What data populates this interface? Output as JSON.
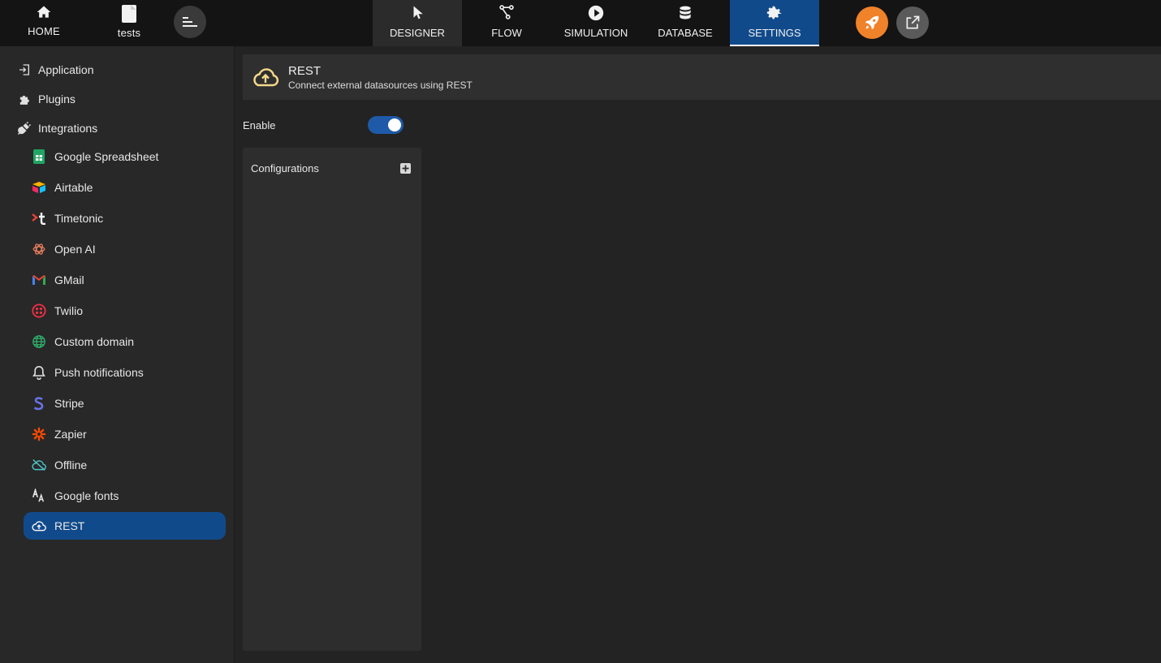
{
  "topbar": {
    "home_label": "HOME",
    "project_label": "tests",
    "tabs": [
      {
        "label": "DESIGNER"
      },
      {
        "label": "FLOW"
      },
      {
        "label": "SIMULATION"
      },
      {
        "label": "DATABASE"
      },
      {
        "label": "SETTINGS"
      }
    ],
    "active_tab": "SETTINGS",
    "colors": {
      "accent": "#114a8b",
      "rocket": "#f0822a"
    }
  },
  "sidebar": {
    "sections": [
      {
        "label": "Application",
        "icon": "login-icon"
      },
      {
        "label": "Plugins",
        "icon": "puzzle-icon"
      },
      {
        "label": "Integrations",
        "icon": "plug-icon"
      }
    ],
    "integrations": [
      {
        "label": "Google Spreadsheet",
        "icon": "google-sheets-icon"
      },
      {
        "label": "Airtable",
        "icon": "airtable-icon"
      },
      {
        "label": "Timetonic",
        "icon": "timetonic-icon"
      },
      {
        "label": "Open AI",
        "icon": "openai-icon"
      },
      {
        "label": "GMail",
        "icon": "gmail-icon"
      },
      {
        "label": "Twilio",
        "icon": "twilio-icon"
      },
      {
        "label": "Custom domain",
        "icon": "globe-icon"
      },
      {
        "label": "Push notifications",
        "icon": "bell-icon"
      },
      {
        "label": "Stripe",
        "icon": "stripe-icon"
      },
      {
        "label": "Zapier",
        "icon": "zapier-icon"
      },
      {
        "label": "Offline",
        "icon": "cloud-off-icon"
      },
      {
        "label": "Google fonts",
        "icon": "font-icon"
      },
      {
        "label": "REST",
        "icon": "cloud-upload-icon"
      }
    ],
    "active": "REST"
  },
  "main": {
    "title": "REST",
    "subtitle": "Connect external datasources using REST",
    "enable_label": "Enable",
    "enabled": true,
    "configurations_label": "Configurations"
  }
}
